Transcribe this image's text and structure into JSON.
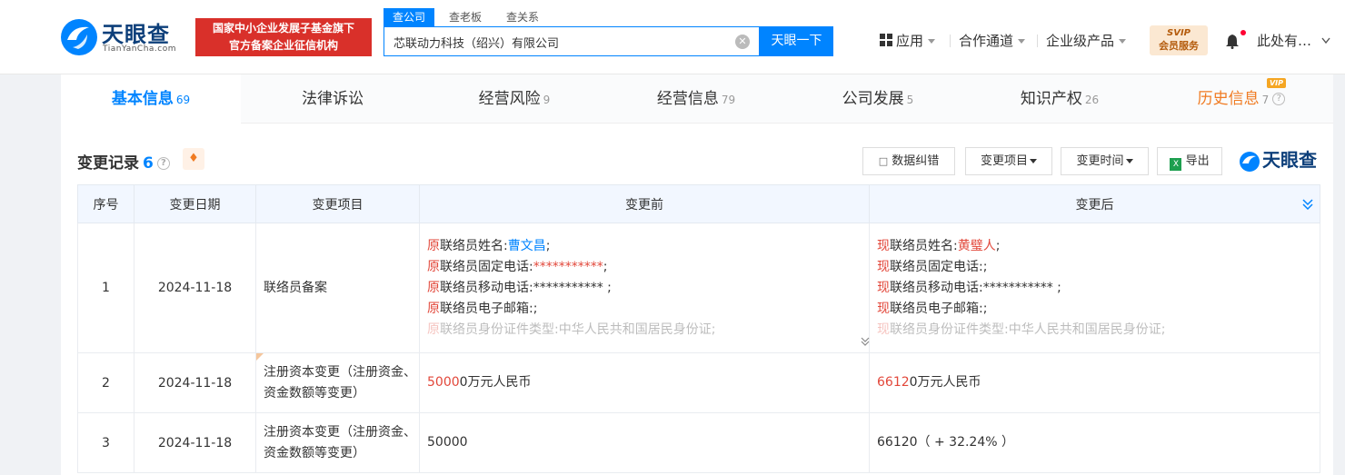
{
  "header": {
    "logo_text": "天眼查",
    "logo_sub": "TianYanCha.com",
    "promo_line1": "国家中小企业发展子基金旗下",
    "promo_line2": "官方备案企业征信机构",
    "search_tabs": [
      "查公司",
      "查老板",
      "查关系"
    ],
    "search_value": "芯联动力科技（绍兴）有限公司",
    "search_button": "天眼一下",
    "nav": [
      "应用",
      "合作通道",
      "企业级产品"
    ],
    "svip_line1": "SVIP",
    "svip_line2": "会员服务",
    "user": "此处有…"
  },
  "tabs": [
    {
      "label": "基本信息",
      "count": "69"
    },
    {
      "label": "法律诉讼",
      "count": ""
    },
    {
      "label": "经营风险",
      "count": "9"
    },
    {
      "label": "经营信息",
      "count": "79"
    },
    {
      "label": "公司发展",
      "count": "5"
    },
    {
      "label": "知识产权",
      "count": "26"
    },
    {
      "label": "历史信息",
      "count": "7",
      "tag": "VIP"
    }
  ],
  "section": {
    "title": "变更记录",
    "count": "6",
    "btn_correct": "数据纠错",
    "btn_item": "变更项目",
    "btn_time": "变更时间",
    "btn_export": "导出",
    "watermark": "天眼查"
  },
  "table": {
    "headers": [
      "序号",
      "变更日期",
      "变更项目",
      "变更前",
      "变更后"
    ],
    "rows": [
      {
        "no": "1",
        "date": "2024-11-18",
        "item": "联络员备案",
        "before": [
          {
            "p": "原",
            "t": "联络员姓名:",
            "v": "曹文昌",
            "e": ";"
          },
          {
            "p": "原",
            "t": "联络员固定电话:",
            "v": "***********",
            "e": ";"
          },
          {
            "p": "原",
            "t": "联络员移动电话:***********",
            "v": "",
            "e": " ;"
          },
          {
            "p": "原",
            "t": "联络员电子邮箱:",
            "v": "",
            "e": ";"
          },
          {
            "p": "原",
            "t": "联络员身份证件类型:中华人民共和国居民身份证;",
            "v": "",
            "e": ""
          }
        ],
        "after": [
          {
            "p": "现",
            "t": "联络员姓名:",
            "v": "黄璧人",
            "e": ";"
          },
          {
            "p": "现",
            "t": "联络员固定电话:",
            "v": "",
            "e": ";"
          },
          {
            "p": "现",
            "t": "联络员移动电话:***********",
            "v": "",
            "e": " ;"
          },
          {
            "p": "现",
            "t": "联络员电子邮箱:",
            "v": "",
            "e": ";"
          },
          {
            "p": "现",
            "t": "联络员身份证件类型:中华人民共和国居民身份证;",
            "v": "",
            "e": ""
          }
        ]
      },
      {
        "no": "2",
        "date": "2024-11-18",
        "item": "注册资本变更（注册资金、资金数额等变更）",
        "before_hl": "5000",
        "before_rest": "0万元人民币",
        "after_hl": "6612",
        "after_rest": "0万元人民币"
      },
      {
        "no": "3",
        "date": "2024-11-18",
        "item": "注册资本变更（注册资金、资金数额等变更）",
        "before": "50000",
        "after": "66120（ + 32.24% ）"
      }
    ]
  }
}
